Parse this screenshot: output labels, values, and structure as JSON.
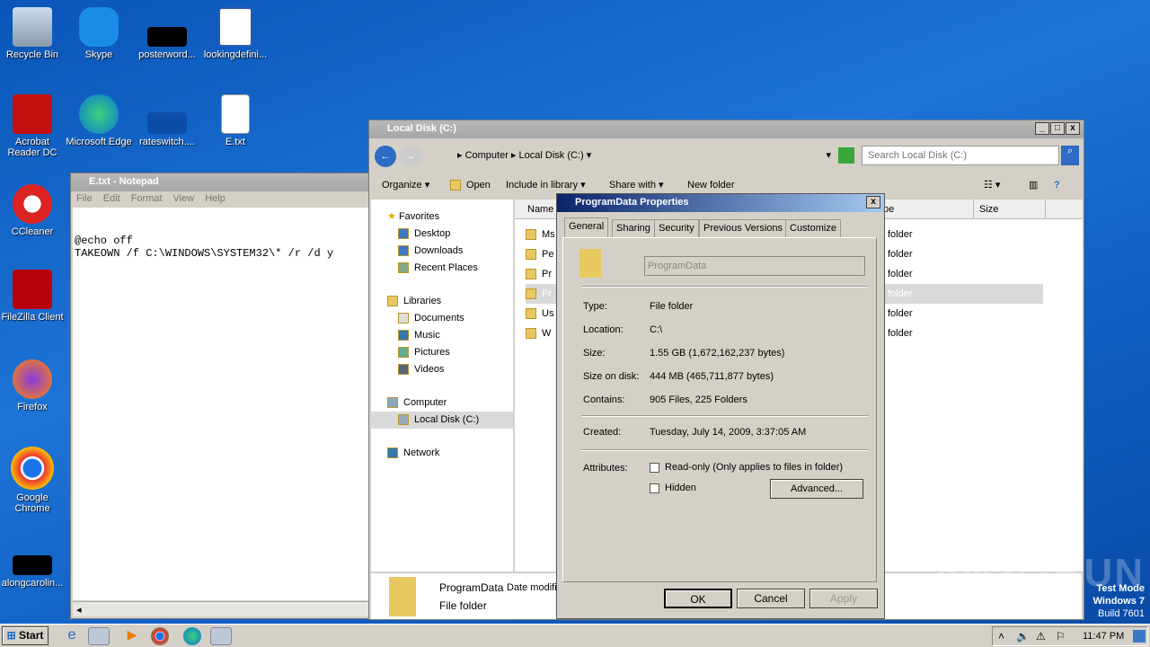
{
  "desktop": {
    "icons": [
      {
        "label": "Recycle Bin",
        "icon": "recycle-bin-icon"
      },
      {
        "label": "Skype",
        "icon": "skype-icon"
      },
      {
        "label": "posterword...",
        "icon": "file-icon"
      },
      {
        "label": "lookingdefini...",
        "icon": "word-document-icon"
      },
      {
        "label": "Acrobat Reader DC",
        "icon": "acrobat-icon"
      },
      {
        "label": "Microsoft Edge",
        "icon": "edge-icon"
      },
      {
        "label": "rateswitch....",
        "icon": "file-icon"
      },
      {
        "label": "E.txt",
        "icon": "text-file-icon"
      },
      {
        "label": "CCleaner",
        "icon": "ccleaner-icon"
      },
      {
        "label": "FileZilla Client",
        "icon": "filezilla-icon"
      },
      {
        "label": "Firefox",
        "icon": "firefox-icon"
      },
      {
        "label": "Google Chrome",
        "icon": "chrome-icon"
      },
      {
        "label": "alongcarolin...",
        "icon": "file-icon"
      }
    ]
  },
  "notepad": {
    "title": "E.txt - Notepad",
    "menu": [
      "File",
      "Edit",
      "Format",
      "View",
      "Help"
    ],
    "lines": [
      "@echo off",
      "TAKEOWN /f C:\\WINDOWS\\SYSTEM32\\* /r /d y"
    ]
  },
  "explorer": {
    "title": "Local Disk (C:)",
    "breadcrumb": [
      "Computer",
      "Local Disk (C:)"
    ],
    "search_placeholder": "Search Local Disk (C:)",
    "toolbar": [
      "Organize",
      "Open",
      "Include in library",
      "Share with",
      "New folder"
    ],
    "nav": {
      "favorites": "Favorites",
      "fav_items": [
        "Desktop",
        "Downloads",
        "Recent Places"
      ],
      "libraries": "Libraries",
      "lib_items": [
        "Documents",
        "Music",
        "Pictures",
        "Videos"
      ],
      "computer": "Computer",
      "local_disk": "Local Disk (C:)",
      "network": "Network"
    },
    "columns": [
      "Name",
      "Type",
      "Size"
    ],
    "rows": [
      {
        "name": "MSOCache",
        "type": "File folder"
      },
      {
        "name": "PerfLogs",
        "type": "File folder"
      },
      {
        "name": "Program Files",
        "type": "File folder"
      },
      {
        "name": "ProgramData",
        "type": "File folder"
      },
      {
        "name": "Users",
        "type": "File folder"
      },
      {
        "name": "Windows",
        "type": "File folder"
      }
    ],
    "row_visible": [
      "Ms",
      "Pe",
      "Pr",
      "Pr",
      "Us",
      "W"
    ],
    "type_visible": "folder",
    "details": {
      "name": "ProgramData",
      "date_label": "Date modifi",
      "type": "File folder"
    }
  },
  "dialog": {
    "title": "ProgramData Properties",
    "tabs": [
      "General",
      "Sharing",
      "Security",
      "Previous Versions",
      "Customize"
    ],
    "name": "ProgramData",
    "fields": [
      {
        "label": "Type:",
        "value": "File folder"
      },
      {
        "label": "Location:",
        "value": "C:\\"
      },
      {
        "label": "Size:",
        "value": "1.55 GB (1,672,162,237 bytes)"
      },
      {
        "label": "Size on disk:",
        "value": "444 MB (465,711,877 bytes)"
      },
      {
        "label": "Contains:",
        "value": "905 Files, 225 Folders"
      }
    ],
    "created_label": "Created:",
    "created": "Tuesday, July 14, 2009, 3:37:05 AM",
    "attributes_label": "Attributes:",
    "readonly": "Read-only (Only applies to files in folder)",
    "hidden": "Hidden",
    "advanced": "Advanced...",
    "ok": "OK",
    "cancel": "Cancel",
    "apply": "Apply"
  },
  "taskbar": {
    "start": "Start",
    "clock": "11:47 PM"
  },
  "watermark": {
    "line1": "Test Mode",
    "line2": "Windows 7",
    "line3": "Build 7601",
    "logo": "ANY RUN"
  }
}
